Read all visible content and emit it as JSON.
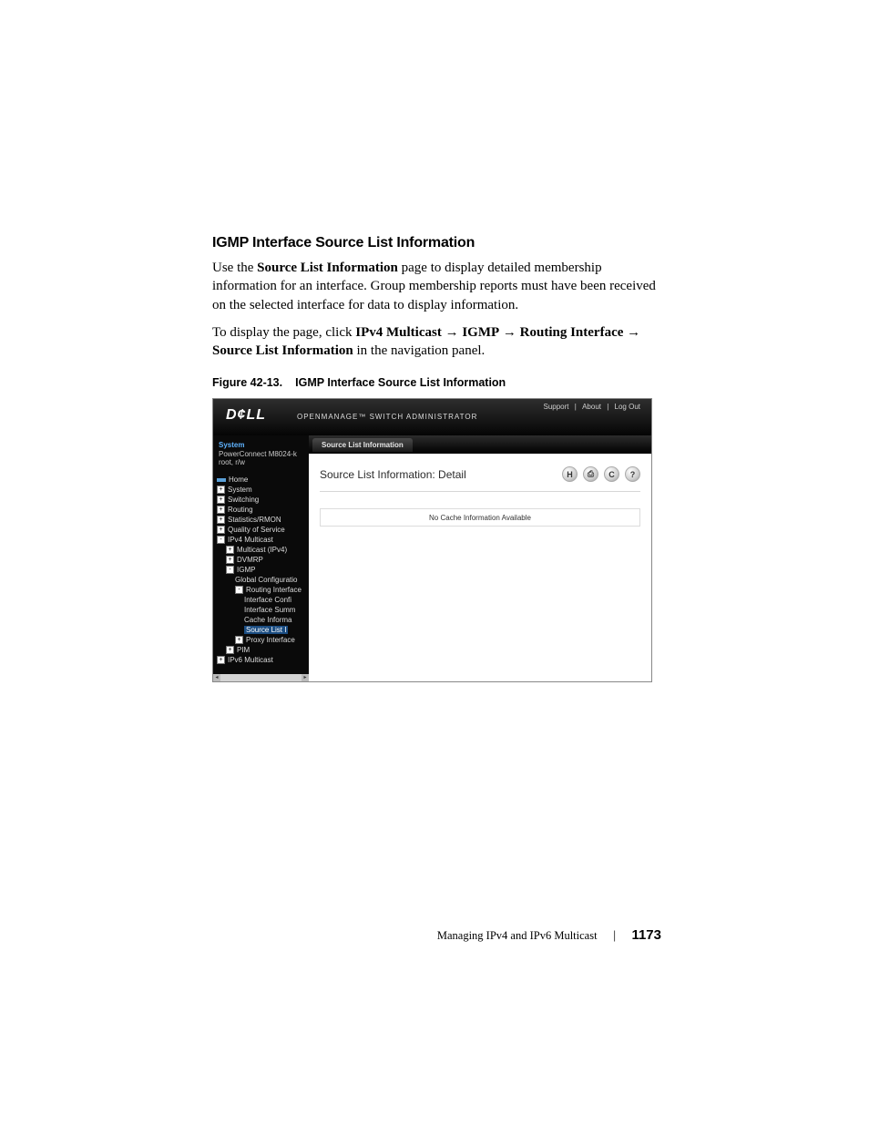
{
  "heading": "IGMP Interface Source List Information",
  "para1_a": "Use the ",
  "para1_b": "Source List Information",
  "para1_c": " page to display detailed membership information for an interface. Group membership reports must have been received on the selected interface for data to display information.",
  "para2_a": "To display the page, click ",
  "para2_b": "IPv4 Multicast",
  "para2_c": "IGMP",
  "para2_d": "Routing Interface",
  "para2_e": "Source List Information",
  "para2_f": " in the navigation panel.",
  "arrow": "→",
  "figure_num": "Figure 42-13.",
  "figure_title": "IGMP Interface Source List Information",
  "ui": {
    "logo": "D¢LL",
    "app_name": "OPENMANAGE™ SWITCH ADMINISTRATOR",
    "toplinks": {
      "support": "Support",
      "about": "About",
      "logout": "Log Out",
      "sep": "|"
    },
    "side_system": "System",
    "side_model": "PowerConnect M8024-k",
    "side_user": "root, r/w",
    "tree": {
      "home": "Home",
      "system": "System",
      "switching": "Switching",
      "routing": "Routing",
      "stats": "Statistics/RMON",
      "qos": "Quality of Service",
      "ipv4m": "IPv4 Multicast",
      "mcast": "Multicast (IPv4)",
      "dvmrp": "DVMRP",
      "igmp": "IGMP",
      "globalcfg": "Global Configuratio",
      "ri": "Routing Interface",
      "ifcfg": "Interface Confi",
      "ifsum": "Interface Summ",
      "cacheinfo": "Cache Informa",
      "sli": "Source List I",
      "proxy": "Proxy Interface",
      "pim": "PIM",
      "ipv6m": "IPv6 Multicast"
    },
    "tab": "Source List Information",
    "panel_title": "Source List Information: Detail",
    "icons": {
      "save": "H",
      "print": "⎙",
      "refresh": "C",
      "help": "?"
    },
    "message": "No Cache Information Available"
  },
  "footer_chapter": "Managing IPv4 and IPv6 Multicast",
  "footer_sep": "|",
  "footer_page": "1173"
}
